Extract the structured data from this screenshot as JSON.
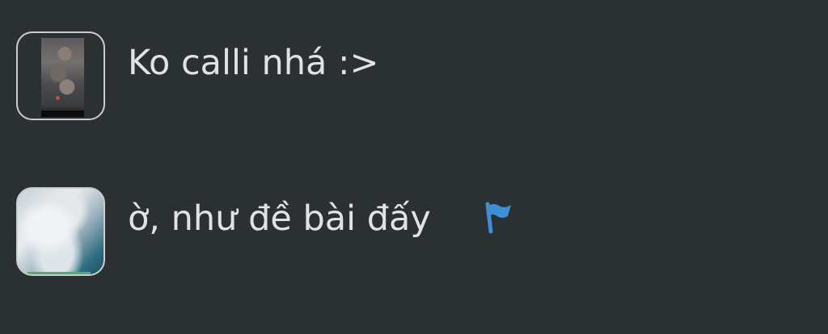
{
  "messages": [
    {
      "text": "Ko calli nhá :>",
      "avatar": "user-avatar-photo"
    },
    {
      "text": "ờ, như đề bài đấy",
      "avatar": "user-avatar-photo",
      "icon": "flag-icon"
    }
  ],
  "colors": {
    "background": "#2b3033",
    "text": "#dfe3e6",
    "flag": "#3d8fd6"
  }
}
